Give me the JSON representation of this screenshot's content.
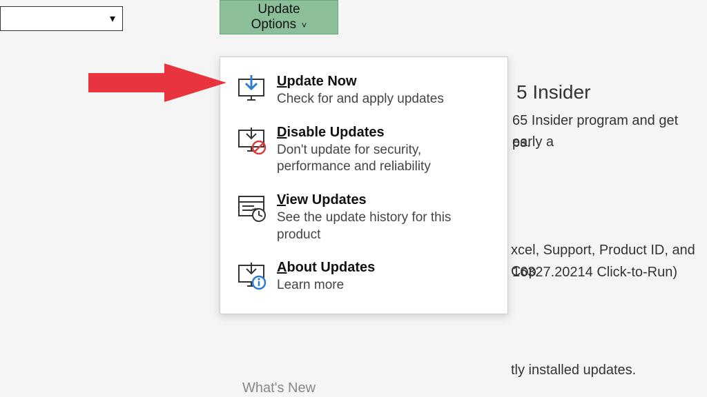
{
  "updateOptionsButton": {
    "label": "Update\nOptions"
  },
  "menu": {
    "items": [
      {
        "title_pre": "U",
        "title_rest": "pdate Now",
        "desc": "Check for and apply updates"
      },
      {
        "title_pre": "D",
        "title_rest": "isable Updates",
        "desc": "Don't update for security, performance and reliability"
      },
      {
        "title_pre": "V",
        "title_rest": "iew Updates",
        "desc": "See the update history for this product"
      },
      {
        "title_pre": "A",
        "title_rest": "bout Updates",
        "desc": "Learn more"
      }
    ]
  },
  "whatsNew": "What's New",
  "bg": {
    "insiderHead": "5 Insider",
    "insiderLine1": "65 Insider program and get early a",
    "insiderLine2": "ps.",
    "excelLine": "xcel, Support, Product ID, and Cop",
    "versionLine": "16327.20214 Click-to-Run)",
    "installedLine": "tly installed updates."
  }
}
